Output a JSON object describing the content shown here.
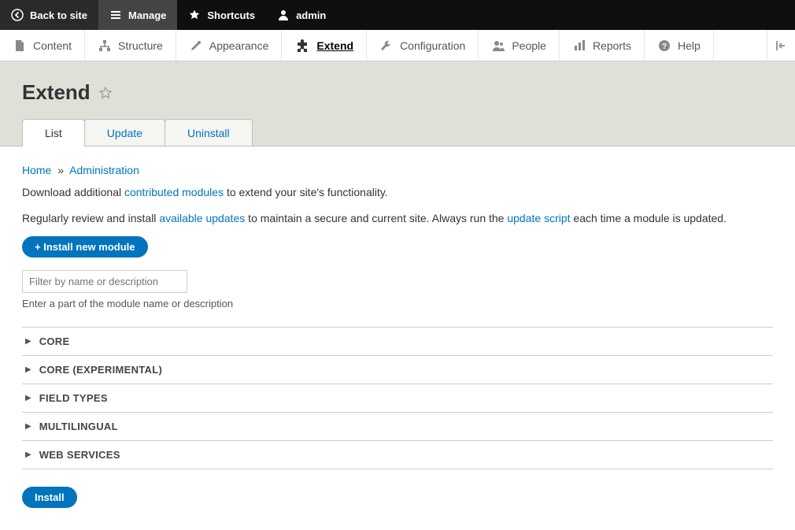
{
  "topbar": {
    "back": "Back to site",
    "manage": "Manage",
    "shortcuts": "Shortcuts",
    "user": "admin"
  },
  "adminbar": {
    "items": [
      {
        "label": "Content"
      },
      {
        "label": "Structure"
      },
      {
        "label": "Appearance"
      },
      {
        "label": "Extend"
      },
      {
        "label": "Configuration"
      },
      {
        "label": "People"
      },
      {
        "label": "Reports"
      },
      {
        "label": "Help"
      }
    ]
  },
  "page": {
    "title": "Extend"
  },
  "tabs": {
    "list": "List",
    "update": "Update",
    "uninstall": "Uninstall"
  },
  "breadcrumb": {
    "home": "Home",
    "sep": "»",
    "admin": "Administration"
  },
  "texts": {
    "download_pre": "Download additional ",
    "download_link": "contributed modules",
    "download_post": " to extend your site's functionality.",
    "review_pre": "Regularly review and install ",
    "review_link": "available updates",
    "review_mid": " to maintain a secure and current site. Always run the ",
    "review_script_link": "update script",
    "review_post": " each time a module is updated."
  },
  "buttons": {
    "install_new": "+ Install new module",
    "install": "Install"
  },
  "filter": {
    "placeholder": "Filter by name or description",
    "help": "Enter a part of the module name or description"
  },
  "groups": [
    {
      "label": "CORE"
    },
    {
      "label": "CORE (EXPERIMENTAL)"
    },
    {
      "label": "FIELD TYPES"
    },
    {
      "label": "MULTILINGUAL"
    },
    {
      "label": "WEB SERVICES"
    }
  ]
}
